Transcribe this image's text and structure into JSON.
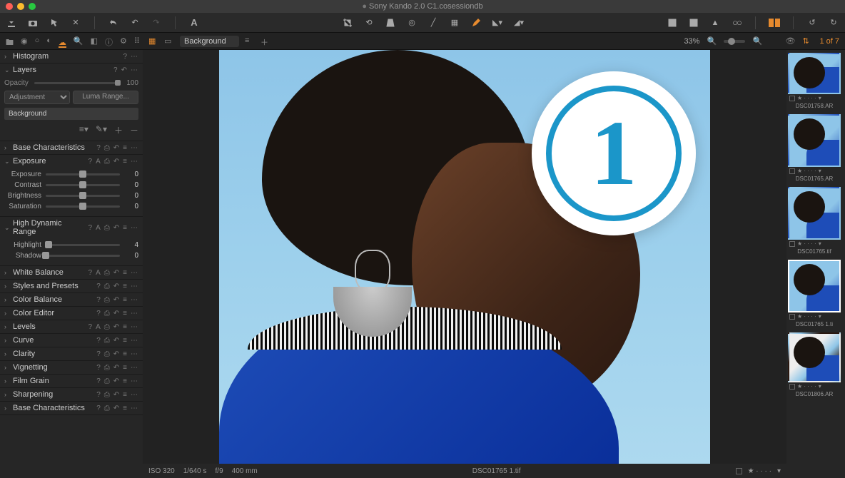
{
  "window": {
    "title": "Sony Kando 2.0 C1.cosessiondb"
  },
  "subbar": {
    "layer_dropdown": "Background",
    "zoom": "33%",
    "counter": "1 of 7"
  },
  "panels": {
    "histogram": {
      "title": "Histogram"
    },
    "layers": {
      "title": "Layers",
      "opacity_label": "Opacity",
      "opacity_value": "100",
      "adjustment": "Adjustment",
      "luma": "Luma Range...",
      "bg": "Background"
    },
    "basechar": {
      "title": "Base Characteristics"
    },
    "exposure": {
      "title": "Exposure",
      "rows": [
        {
          "name": "Exposure",
          "val": "0",
          "pos": 50
        },
        {
          "name": "Contrast",
          "val": "0",
          "pos": 50
        },
        {
          "name": "Brightness",
          "val": "0",
          "pos": 50
        },
        {
          "name": "Saturation",
          "val": "0",
          "pos": 50
        }
      ]
    },
    "hdr": {
      "title": "High Dynamic Range",
      "rows": [
        {
          "name": "Highlight",
          "val": "4",
          "pos": 4
        },
        {
          "name": "Shadow",
          "val": "0",
          "pos": 0
        }
      ]
    },
    "rest": [
      "White Balance",
      "Styles and Presets",
      "Color Balance",
      "Color Editor",
      "Levels",
      "Curve",
      "Clarity",
      "Vignetting",
      "Film Grain",
      "Sharpening",
      "Base Characteristics"
    ]
  },
  "info": {
    "iso": "ISO 320",
    "shutter": "1/640 s",
    "aperture": "f/9",
    "focal": "400 mm",
    "filename": "DSC01765 1.tif"
  },
  "thumbs": [
    {
      "name": "DSC01758.AR",
      "selected": false,
      "clip": "top"
    },
    {
      "name": "DSC01765.AR",
      "selected": false
    },
    {
      "name": "DSC01765.tif",
      "selected": false
    },
    {
      "name": "DSC01765 1.ti",
      "selected": true
    },
    {
      "name": "DSC01806.AR",
      "selected": false,
      "last": true
    }
  ],
  "logo_char": "1"
}
